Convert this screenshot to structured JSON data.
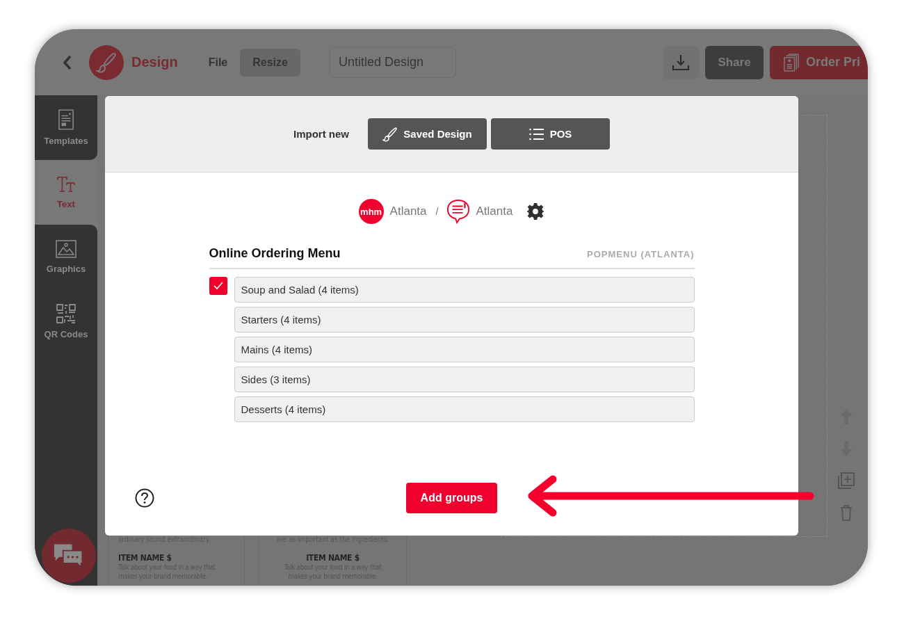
{
  "top_bar": {
    "app_name": "Design",
    "menu": [
      {
        "label": "File",
        "highlighted": false
      },
      {
        "label": "Resize",
        "highlighted": true
      }
    ],
    "title_field": {
      "value": "Untitled Design"
    },
    "share_button": "Share",
    "order_button": "Order Pri"
  },
  "sidebar": {
    "items": [
      {
        "label": "Templates",
        "kind": "templates",
        "selected": false
      },
      {
        "label": "Text",
        "kind": "text",
        "selected": true
      },
      {
        "label": "Graphics",
        "kind": "graphics",
        "selected": false
      },
      {
        "label": "QR Codes",
        "kind": "qr",
        "selected": false
      }
    ]
  },
  "canvas": {
    "columns": [
      {
        "intro": "ordinary sound extraordinary.",
        "item_name": "ITEM NAME $",
        "description_lines": [
          "Talk about your food in a way that",
          "makes your brand memorable."
        ],
        "kind": "left"
      },
      {
        "intro": "are as important as the ingredients.",
        "item_name": "ITEM NAME $",
        "description_lines": [
          "Talk about your food in a way that",
          "makes your brand memorable."
        ],
        "kind": "center"
      }
    ]
  },
  "modal": {
    "import_label": "Import new",
    "import_buttons": [
      {
        "label": "Saved Design",
        "kind": "brush"
      },
      {
        "label": "POS",
        "kind": "list"
      }
    ],
    "breadcrumb": {
      "account_logo": "mhm",
      "account": "Atlanta",
      "separator": "/",
      "location": "Atlanta"
    },
    "section": {
      "title": "Online Ordering Menu",
      "source": "POPMENU (ATLANTA)",
      "groups": [
        {
          "label": "Soup and Salad (4 items)",
          "checked": true
        },
        {
          "label": "Starters (4 items)",
          "checked": false
        },
        {
          "label": "Mains (4 items)",
          "checked": false
        },
        {
          "label": "Sides (3 items)",
          "checked": false
        },
        {
          "label": "Desserts (4 items)",
          "checked": false
        }
      ]
    },
    "submit_button": "Add groups"
  }
}
